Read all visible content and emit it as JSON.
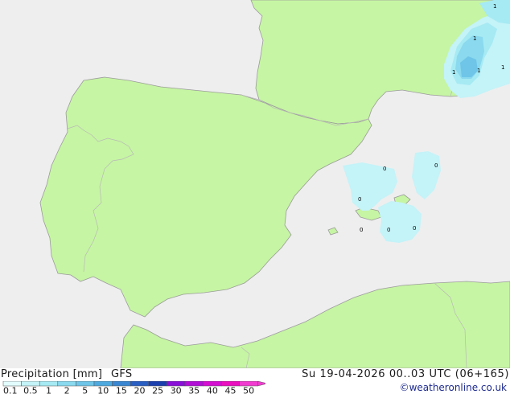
{
  "header": {
    "title": "Precipitation [mm]",
    "model": "GFS",
    "valid_time": "Su 19-04-2026 00..03 UTC (06+165)",
    "credit": "©weatheronline.co.uk"
  },
  "colors": {
    "land": "#c6f5a3",
    "sea": "#eeeeee",
    "coast": "#9b9b9b",
    "border": "#b9b9b9"
  },
  "legend": {
    "labels": [
      "0.1",
      "0.5",
      "1",
      "2",
      "5",
      "10",
      "15",
      "20",
      "25",
      "30",
      "35",
      "40",
      "45",
      "50"
    ],
    "colors": [
      "#e2fbfd",
      "#c4f3f8",
      "#a6eaf3",
      "#8ad9ee",
      "#6ec5e8",
      "#4ea9de",
      "#3a86d2",
      "#2a5fc2",
      "#1c3fae",
      "#8a10d8",
      "#b10fd6",
      "#d40fd2",
      "#ea0fbf",
      "#f03cd0"
    ]
  },
  "value_markers": [
    {
      "value": "1"
    },
    {
      "value": "1"
    },
    {
      "value": "1"
    },
    {
      "value": "1"
    },
    {
      "value": "1"
    },
    {
      "value": "0"
    },
    {
      "value": "0"
    },
    {
      "value": "0"
    },
    {
      "value": "0"
    },
    {
      "value": "0"
    },
    {
      "value": "0"
    }
  ]
}
